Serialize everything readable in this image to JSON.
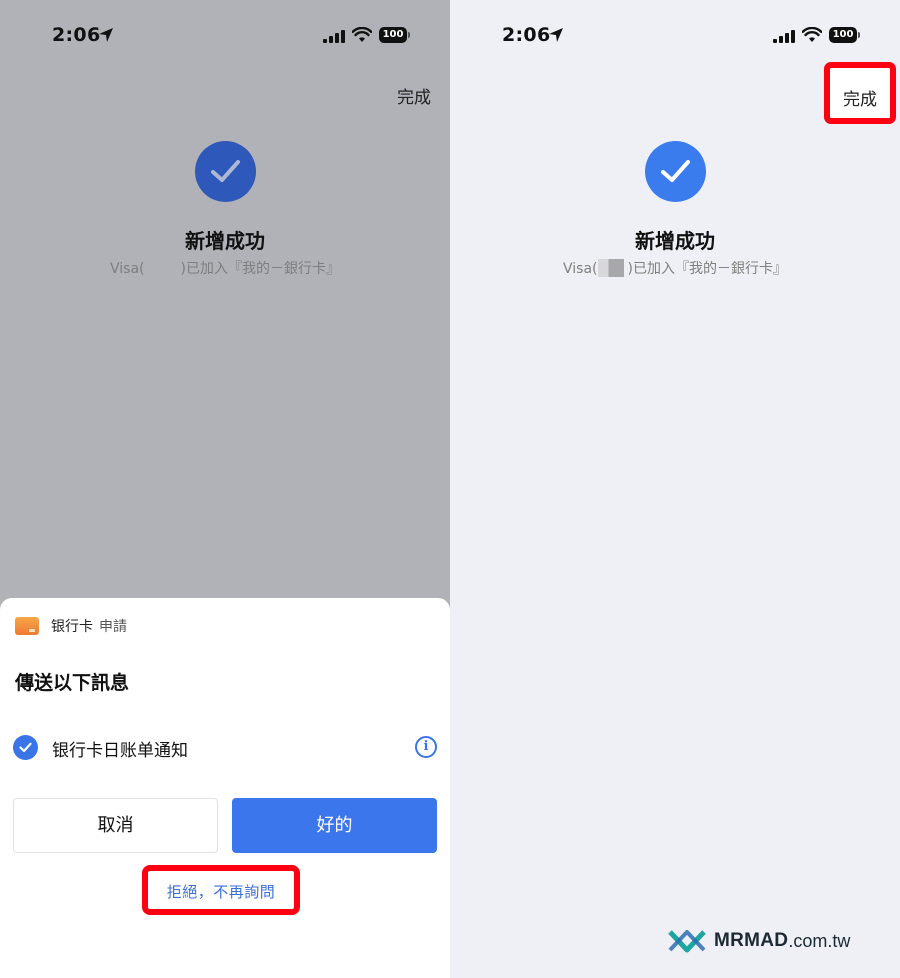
{
  "status": {
    "time": "2:06",
    "battery": "100"
  },
  "success": {
    "done_label": "完成",
    "title": "新增成功",
    "card_prefix": "Visa(",
    "card_suffix": ")已加入『我的－銀行卡』"
  },
  "sheet": {
    "app_name": "银行卡",
    "app_action": "申請",
    "title": "傳送以下訊息",
    "permission": "银行卡日账单通知",
    "cancel_label": "取消",
    "ok_label": "好的",
    "reject_label": "拒絕，不再詢問",
    "info_symbol": "i"
  },
  "watermark": {
    "brand": "MRMAD",
    "tld": ".com.tw"
  },
  "colors": {
    "accent_blue": "#3b76ec",
    "highlight_red": "#ff0012",
    "dim_overlay": "#b1b2b7",
    "page_bg": "#eff0f5"
  }
}
